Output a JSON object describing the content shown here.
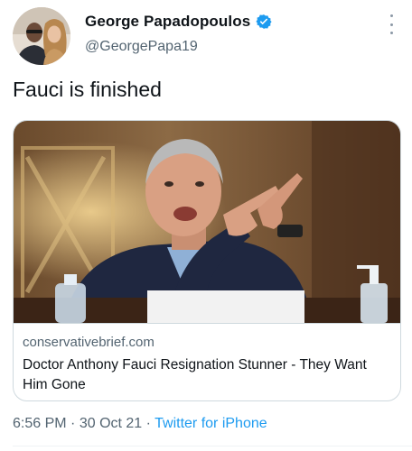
{
  "author": {
    "display_name": "George Papadopoulos",
    "handle": "@GeorgePapa19",
    "verified": true
  },
  "tweet": {
    "text": "Fauci is finished"
  },
  "link_card": {
    "domain": "conservativebrief.com",
    "title": "Doctor Anthony Fauci Resignation Stunner - They Want Him Gone",
    "image_desc_icon": "news-photo"
  },
  "footer": {
    "time": "6:56 PM",
    "separator": "·",
    "date": "30 Oct 21",
    "source": "Twitter for iPhone"
  },
  "colors": {
    "accent": "#1d9bf0",
    "text": "#0f1419",
    "secondary": "#536471",
    "border": "#cfd9de"
  }
}
